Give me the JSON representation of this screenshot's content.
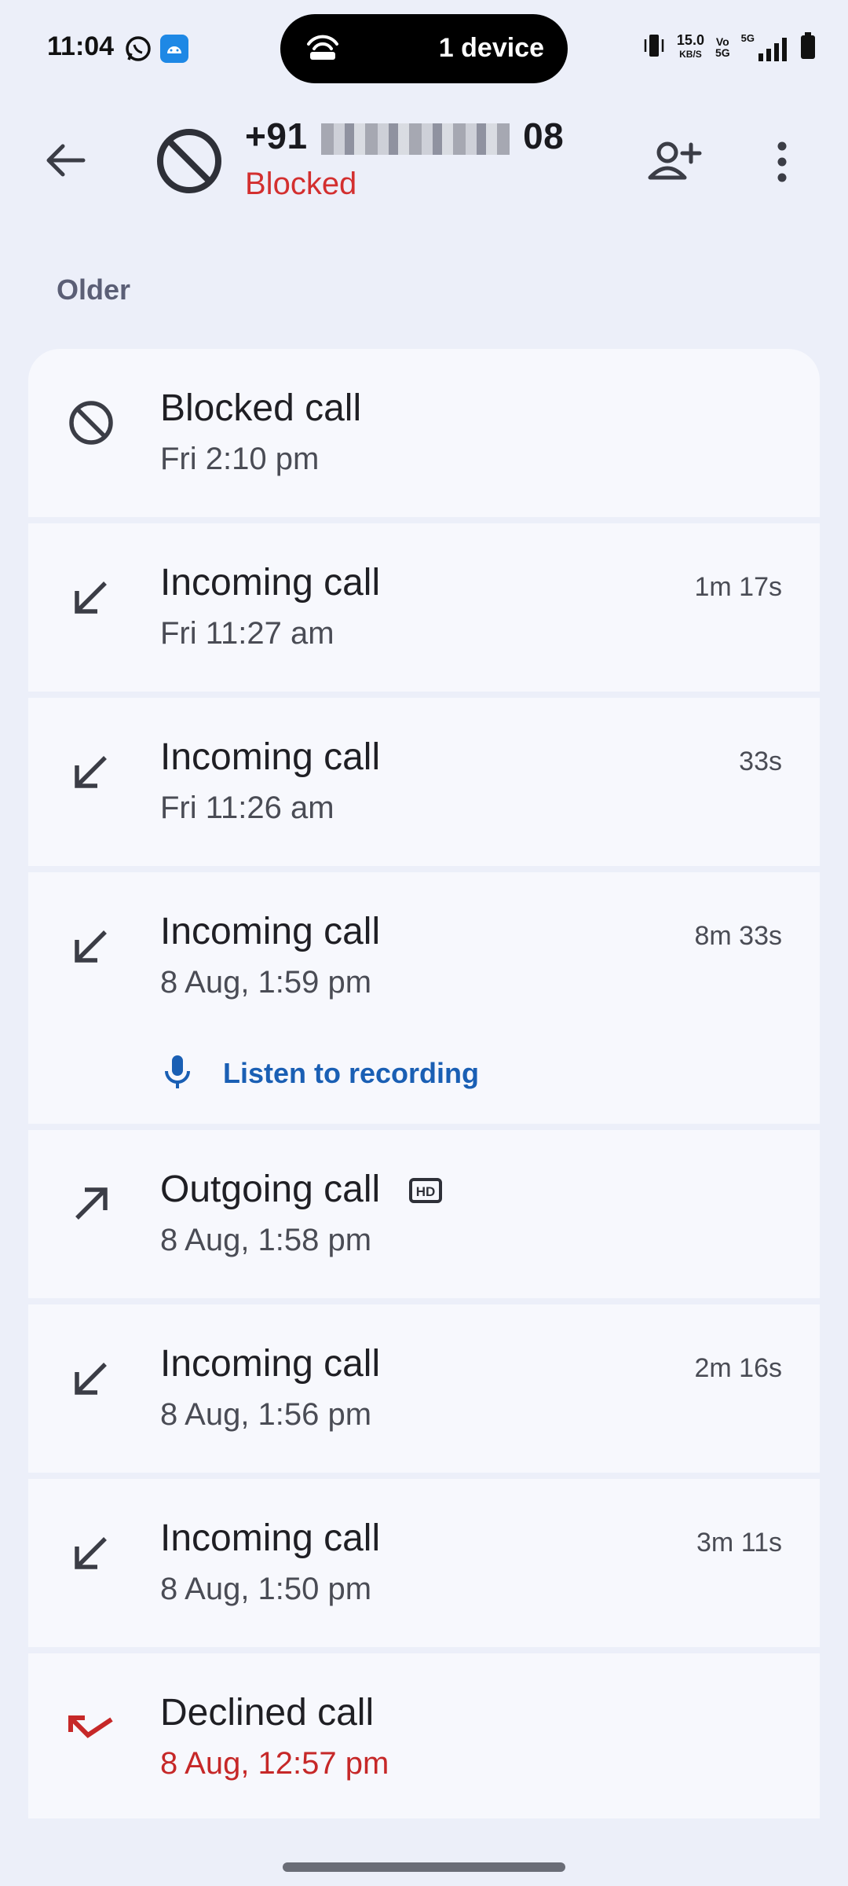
{
  "status_bar": {
    "time": "11:04",
    "pill_text": "1 device",
    "speed_value": "15.0",
    "speed_unit": "KB/S",
    "volte": "Vo",
    "volte_sub": "5G",
    "network": "5G",
    "icons": [
      "whatsapp-icon",
      "android-icon",
      "hotspot-icon",
      "vibrate-icon",
      "signal-icon",
      "battery-icon"
    ]
  },
  "header": {
    "number_prefix": "+91",
    "number_suffix": "08",
    "status": "Blocked",
    "status_color": "#d32f2f"
  },
  "section_label": "Older",
  "calls": [
    {
      "type": "Blocked call",
      "time": "Fri 2:10 pm",
      "duration": "",
      "icon": "blocked-icon"
    },
    {
      "type": "Incoming call",
      "time": "Fri 11:27 am",
      "duration": "1m 17s",
      "icon": "incoming-call-icon"
    },
    {
      "type": "Incoming call",
      "time": "Fri 11:26 am",
      "duration": "33s",
      "icon": "incoming-call-icon"
    },
    {
      "type": "Incoming call",
      "time": "8 Aug, 1:59 pm",
      "duration": "8m 33s",
      "icon": "incoming-call-icon",
      "recording_label": "Listen to recording"
    },
    {
      "type": "Outgoing call",
      "time": "8 Aug, 1:58 pm",
      "duration": "",
      "icon": "outgoing-call-icon",
      "badge": "HD"
    },
    {
      "type": "Incoming call",
      "time": "8 Aug, 1:56 pm",
      "duration": "2m 16s",
      "icon": "incoming-call-icon"
    },
    {
      "type": "Incoming call",
      "time": "8 Aug, 1:50 pm",
      "duration": "3m 11s",
      "icon": "incoming-call-icon"
    },
    {
      "type": "Declined call",
      "time": "8 Aug, 12:57 pm",
      "duration": "",
      "icon": "declined-call-icon"
    }
  ],
  "colors": {
    "background": "#eceff9",
    "card": "#f7f8fd",
    "accent_link": "#1a5fb4",
    "declined": "#c62828"
  }
}
